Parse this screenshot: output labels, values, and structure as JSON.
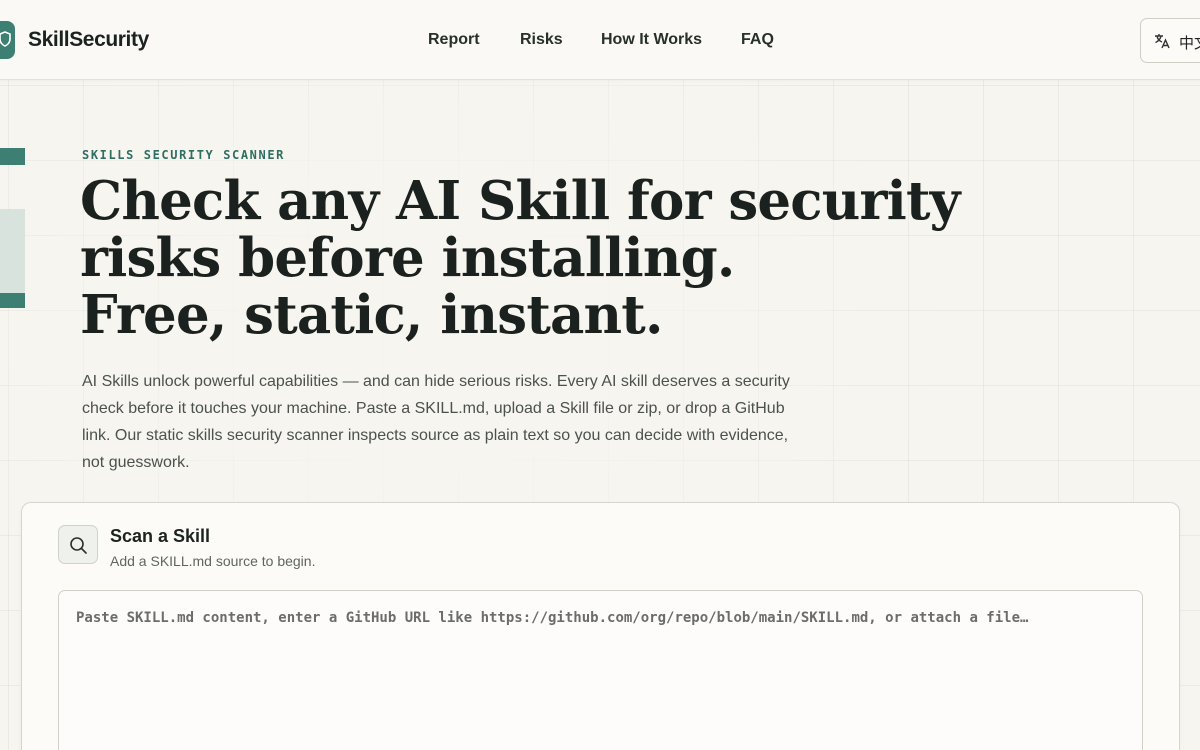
{
  "header": {
    "brand": "SkillSecurity",
    "nav": [
      {
        "label": "Report"
      },
      {
        "label": "Risks"
      },
      {
        "label": "How It Works"
      },
      {
        "label": "FAQ"
      }
    ],
    "language_label": "中文"
  },
  "hero": {
    "eyebrow": "SKILLS SECURITY SCANNER",
    "headline": [
      "Check any AI Skill for security",
      "risks before installing.",
      "Free, static, instant."
    ],
    "description": "AI Skills unlock powerful capabilities — and can hide serious risks. Every AI skill deserves a security check before it touches your machine. Paste a SKILL.md, upload a Skill file or zip, or drop a GitHub link. Our static skills security scanner inspects source as plain text so you can decide with evidence, not guesswork."
  },
  "scan": {
    "title": "Scan a Skill",
    "subtitle": "Add a SKILL.md source to begin.",
    "input_placeholder": "Paste SKILL.md content, enter a GitHub URL like https://github.com/org/repo/blob/main/SKILL.md, or attach a file…",
    "input_value": ""
  },
  "colors": {
    "accent": "#3d7f72",
    "background": "#f7f5ef",
    "text": "#1b211e"
  },
  "icons": {
    "logo": "shield-check-icon",
    "language": "translate-icon",
    "scan": "search-icon"
  }
}
